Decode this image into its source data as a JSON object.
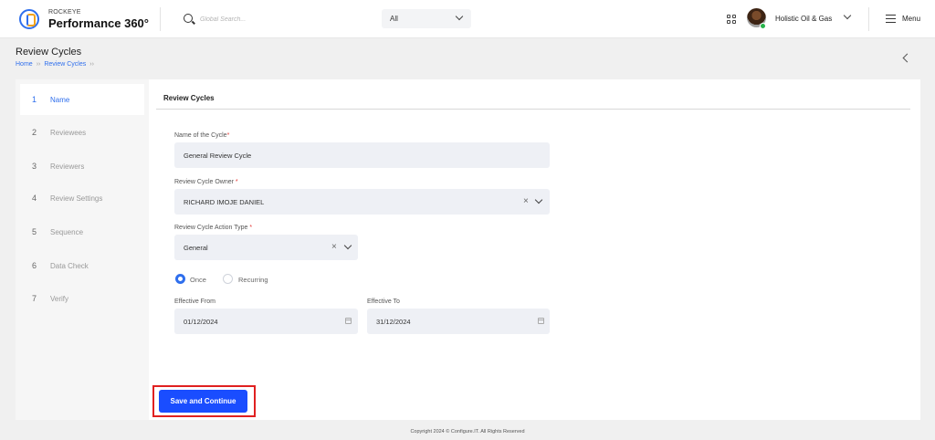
{
  "app": {
    "brand_top": "ROCKEYE",
    "brand_name": "Performance 360°"
  },
  "header": {
    "search_placeholder": "Global Search...",
    "scope_value": "All",
    "org_name": "Holistic Oil & Gas",
    "menu_label": "Menu"
  },
  "page": {
    "title": "Review Cycles",
    "breadcrumb": [
      "Home",
      "Review Cycles"
    ]
  },
  "steps": [
    {
      "num": "1",
      "label": "Name"
    },
    {
      "num": "2",
      "label": "Reviewees"
    },
    {
      "num": "3",
      "label": "Reviewers"
    },
    {
      "num": "4",
      "label": "Review Settings"
    },
    {
      "num": "5",
      "label": "Sequence"
    },
    {
      "num": "6",
      "label": "Data Check"
    },
    {
      "num": "7",
      "label": "Verify"
    }
  ],
  "form": {
    "section_title": "Review Cycles",
    "name_label": "Name of the Cycle",
    "name_value": "General Review Cycle",
    "owner_label": "Review Cycle Owner ",
    "owner_value": "RICHARD IMOJE DANIEL",
    "action_type_label": "Review Cycle Action Type ",
    "action_type_value": "General",
    "frequency_options": [
      "Once",
      "Recurring"
    ],
    "frequency_selected": "Once",
    "effective_from_label": "Effective From",
    "effective_from_value": "01/12/2024",
    "effective_to_label": "Effective To",
    "effective_to_value": "31/12/2024",
    "required_marker": "*",
    "clear_glyph": "×",
    "save_label": "Save and Continue"
  },
  "footer": {
    "text": "Copyright 2024 © Configure.IT. All Rights Reserved"
  },
  "colors": {
    "accent": "#2f6fed",
    "primary_button": "#1a4dff",
    "highlight_outline": "#e02020",
    "field_background": "#eef0f5"
  },
  "icons": [
    "search-icon",
    "chevron-down-icon",
    "apps-grid-icon",
    "hamburger-icon",
    "chevron-left-icon",
    "clear-icon",
    "calendar-icon"
  ]
}
